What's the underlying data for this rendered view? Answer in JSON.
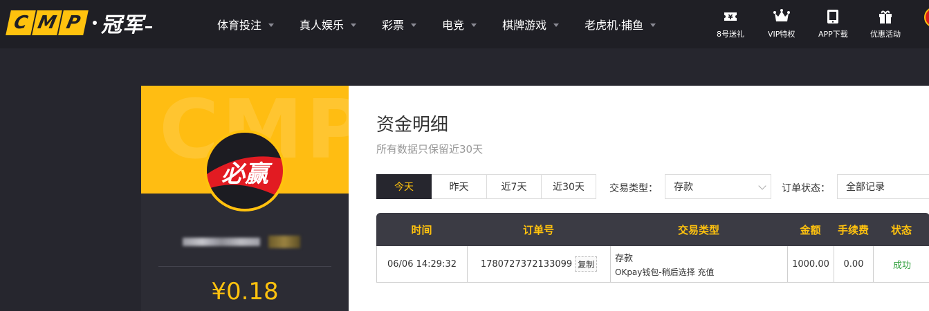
{
  "header": {
    "logo_letters": [
      "C",
      "M",
      "P"
    ],
    "logo_cn": "冠军",
    "nav": [
      {
        "label": "体育投注"
      },
      {
        "label": "真人娱乐"
      },
      {
        "label": "彩票"
      },
      {
        "label": "电竞"
      },
      {
        "label": "棋牌游戏"
      },
      {
        "label": "老虎机·捕鱼"
      }
    ],
    "quick_links": [
      {
        "label": "8号送礼",
        "icon": "ticket-yen-icon"
      },
      {
        "label": "VIP特权",
        "icon": "crown-icon"
      },
      {
        "label": "APP下载",
        "icon": "phone-icon"
      },
      {
        "label": "优惠活动",
        "icon": "gift-icon"
      }
    ],
    "accent_color": "#ffc20e"
  },
  "profile": {
    "watermark": "CMP",
    "avatar_text": "必赢",
    "balance": "¥0.18"
  },
  "main": {
    "title": "资金明细",
    "subtitle": "所有数据只保留近30天",
    "date_tabs": [
      {
        "label": "今天",
        "active": true
      },
      {
        "label": "昨天",
        "active": false
      },
      {
        "label": "近7天",
        "active": false
      },
      {
        "label": "近30天",
        "active": false
      }
    ],
    "filters": {
      "type_label": "交易类型：",
      "type_value": "存款",
      "status_label": "订单状态：",
      "status_value": "全部记录"
    },
    "table": {
      "headers": [
        "时间",
        "订单号",
        "交易类型",
        "金额",
        "手续费",
        "状态"
      ],
      "rows": [
        {
          "time": "06/06 14:29:32",
          "order_no": "1780727372133099",
          "copy_label": "复制",
          "type_main": "存款",
          "type_sub": "OKpay钱包-稍后选择 充值",
          "amount": "1000.00",
          "fee": "0.00",
          "status": "成功"
        }
      ]
    }
  }
}
